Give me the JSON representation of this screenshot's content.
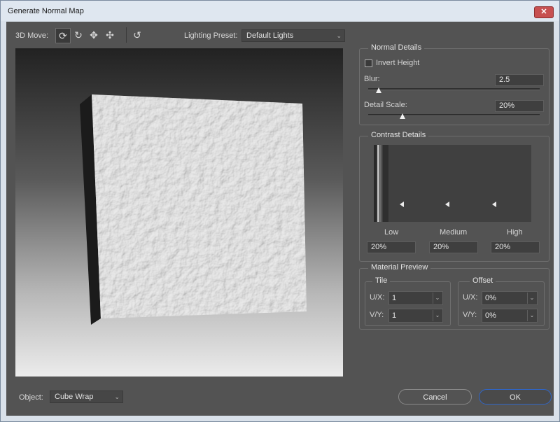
{
  "window": {
    "title": "Generate Normal Map",
    "close_glyph": "✕"
  },
  "toolbar": {
    "move_label": "3D Move:",
    "tools": [
      {
        "name": "orbit-icon",
        "glyph": "⟳"
      },
      {
        "name": "roll-icon",
        "glyph": "↻"
      },
      {
        "name": "pan-icon",
        "glyph": "✥"
      },
      {
        "name": "slide-icon",
        "glyph": "✣"
      }
    ],
    "reset_glyph": "↺",
    "lighting_label": "Lighting Preset:",
    "lighting_value": "Default Lights"
  },
  "normal_details": {
    "title": "Normal Details",
    "invert_label": "Invert Height",
    "invert_checked": false,
    "blur_label": "Blur:",
    "blur_value": "2.5",
    "blur_level": 0.06,
    "detail_label": "Detail Scale:",
    "detail_value": "20%",
    "detail_level": 0.2
  },
  "contrast_details": {
    "title": "Contrast Details",
    "low_label": "Low",
    "medium_label": "Medium",
    "high_label": "High",
    "low_value": "20%",
    "medium_value": "20%",
    "high_value": "20%"
  },
  "material_preview": {
    "title": "Material Preview",
    "tile_title": "Tile",
    "offset_title": "Offset",
    "ux_label": "U/X:",
    "vy_label": "V/Y:",
    "tile_ux": "1",
    "tile_vy": "1",
    "offset_ux": "0%",
    "offset_vy": "0%"
  },
  "object": {
    "label": "Object:",
    "value": "Cube Wrap"
  },
  "buttons": {
    "cancel": "Cancel",
    "ok": "OK"
  },
  "icons": {
    "dropdown": "⌄",
    "combo": "⌄"
  }
}
